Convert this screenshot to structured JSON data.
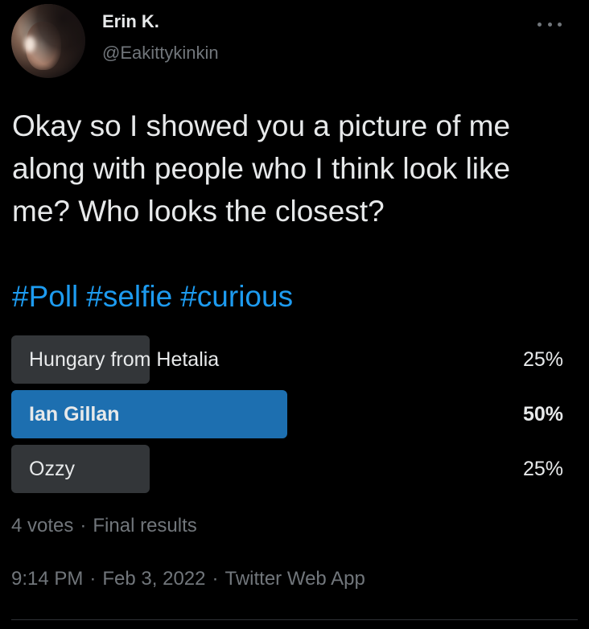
{
  "author": {
    "display_name": "Erin K.",
    "handle": "@Eakittykinkin"
  },
  "tweet": {
    "text": "Okay so I showed you a picture of me along with people who I think look like me? Who looks the closest?",
    "hashtags": [
      "#Poll",
      "#selfie",
      "#curious"
    ]
  },
  "poll": {
    "options": [
      {
        "label": "Hungary from Hetalia",
        "percent_text": "25%",
        "percent": 25,
        "winner": false
      },
      {
        "label": "Ian Gillan",
        "percent_text": "50%",
        "percent": 50,
        "winner": true
      },
      {
        "label": "Ozzy",
        "percent_text": "25%",
        "percent": 25,
        "winner": false
      }
    ],
    "votes": "4 votes",
    "status": "Final results"
  },
  "meta": {
    "time": "9:14 PM",
    "date": "Feb 3, 2022",
    "source": "Twitter Web App",
    "separator": "·"
  },
  "colors": {
    "background": "#000000",
    "text": "#e7e9ea",
    "muted": "#71767b",
    "accent": "#1d9bf0",
    "poll_winner": "#1d6fb0",
    "poll_bar": "#333639"
  },
  "icons": {
    "more": "more-horizontal-icon"
  }
}
